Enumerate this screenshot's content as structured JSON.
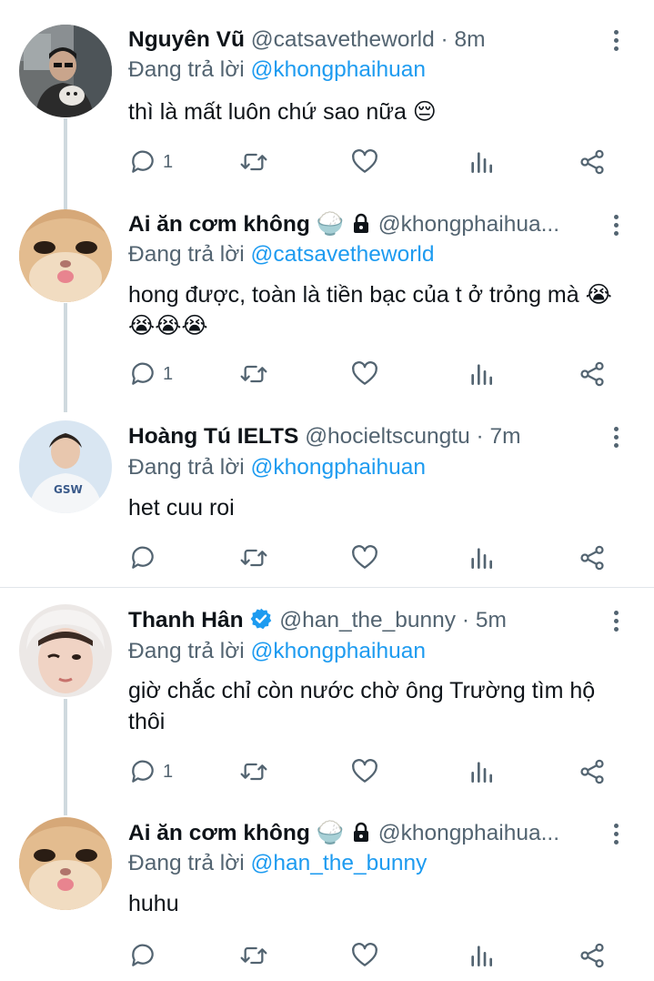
{
  "replying_prefix": "Đang trả lời",
  "tweets": [
    {
      "name": "Nguyên Vũ",
      "handle": "@catsavetheworld",
      "sep": "·",
      "time": "8m",
      "replying_to": "@khongphaihuan",
      "text": "thì là mất luôn chứ sao nữa 😔",
      "reply_count": "1"
    },
    {
      "name": "Ai ăn cơm không",
      "name_emoji": "🍚",
      "handle": "@khongphaihua...",
      "replying_to": "@catsavetheworld",
      "text": "hong được, toàn là tiền bạc của t ở trỏng mà 😭😭😭😭",
      "reply_count": "1"
    },
    {
      "name": "Hoàng Tú IELTS",
      "handle": "@hocieltscungtu",
      "sep": "·",
      "time": "7m",
      "replying_to": "@khongphaihuan",
      "text": "het cuu roi",
      "reply_count": ""
    },
    {
      "name": "Thanh Hân",
      "handle": "@han_the_bunny",
      "sep": "·",
      "time": "5m",
      "replying_to": "@khongphaihuan",
      "text": "giờ chắc chỉ còn nước chờ ông Trường tìm hộ thôi",
      "reply_count": "1"
    },
    {
      "name": "Ai ăn cơm không",
      "name_emoji": "🍚",
      "handle": "@khongphaihua...",
      "replying_to": "@han_the_bunny",
      "text": "huhu",
      "reply_count": ""
    }
  ],
  "icons": {
    "reply": "reply-icon",
    "retweet": "retweet-icon",
    "like": "heart-icon",
    "views": "views-icon",
    "share": "share-icon",
    "more": "more-icon",
    "verified": "verified-badge-icon",
    "lock": "lock-icon"
  },
  "colors": {
    "accent": "#1d9bf0",
    "secondary_text": "#536471",
    "thread_line": "#cfd9de"
  }
}
